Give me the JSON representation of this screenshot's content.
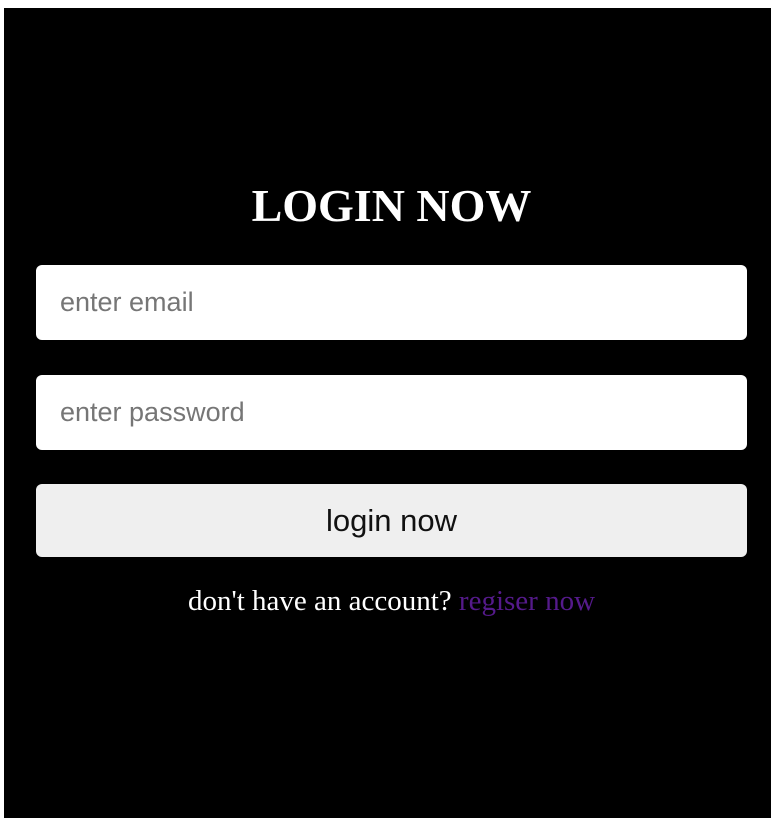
{
  "login": {
    "title": "LOGIN NOW",
    "email": {
      "placeholder": "enter email",
      "value": ""
    },
    "password": {
      "placeholder": "enter password",
      "value": ""
    },
    "submit_label": "login now",
    "footer": {
      "prompt": "don't have an account?",
      "link_label": "regiser now"
    }
  },
  "colors": {
    "background": "#000000",
    "link": "#551a8b",
    "button": "#efefef"
  }
}
